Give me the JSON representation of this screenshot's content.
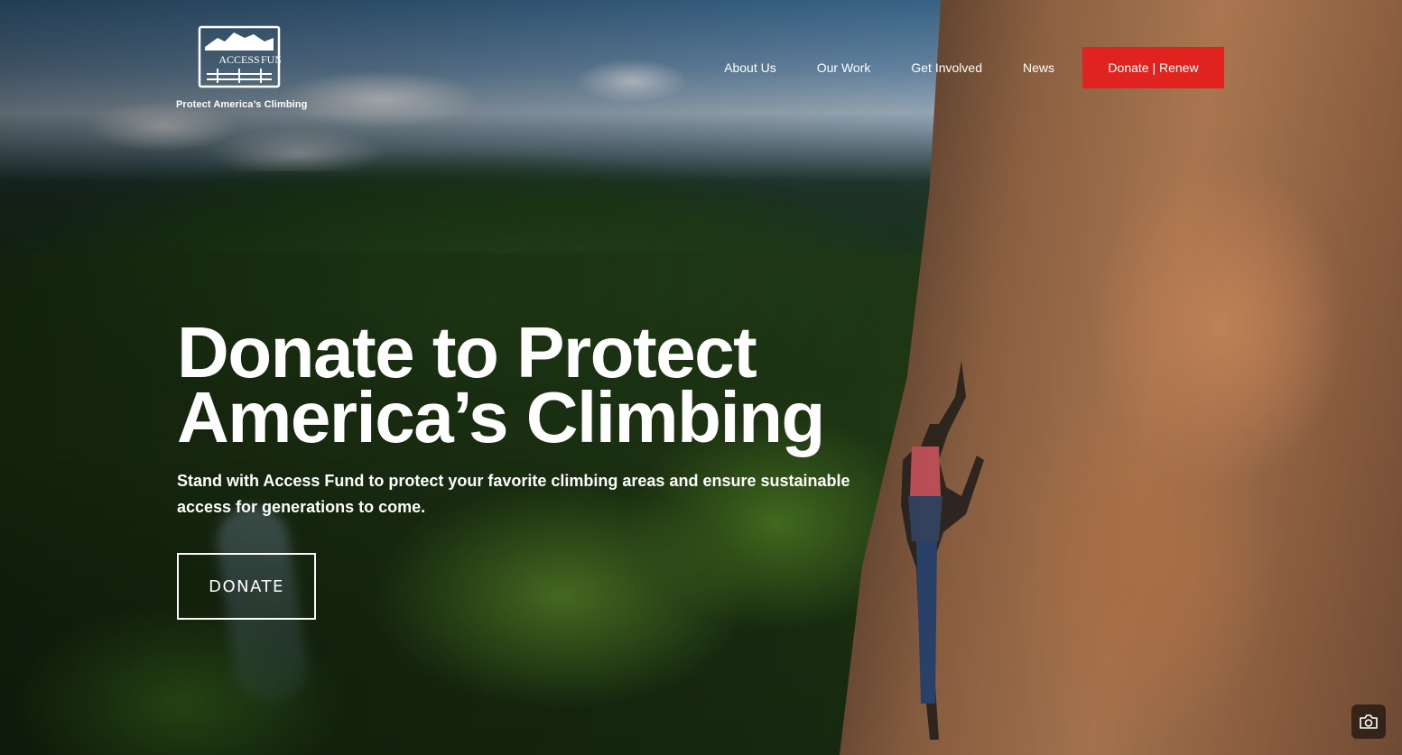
{
  "brand": {
    "logo_line1": "ACCESS",
    "logo_line2": "FUND",
    "tagline": "Protect America’s Climbing"
  },
  "nav": {
    "items": [
      "About Us",
      "Our Work",
      "Get Involved",
      "News"
    ],
    "cta": "Donate | Renew",
    "cta_color": "#e0231e"
  },
  "hero": {
    "title_line1": "Donate to Protect",
    "title_line2": "America’s Climbing",
    "subtitle": "Stand with Access Fund to protect your favorite climbing areas and ensure sustainable access for generations to come.",
    "button": "DONATE"
  },
  "icons": {
    "camera": "camera-icon"
  }
}
